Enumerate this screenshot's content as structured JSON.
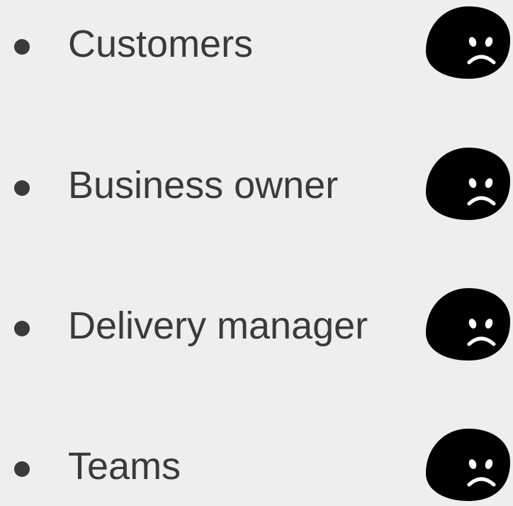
{
  "items": [
    {
      "label": "Customers",
      "icon": "sad-face-icon"
    },
    {
      "label": "Business owner",
      "icon": "sad-face-icon"
    },
    {
      "label": "Delivery manager",
      "icon": "sad-face-icon"
    },
    {
      "label": "Teams",
      "icon": "sad-face-icon"
    }
  ],
  "colors": {
    "background": "#eeeeee",
    "text": "#3a3a3a",
    "icon_fill": "#000000",
    "icon_features": "#ffffff"
  }
}
